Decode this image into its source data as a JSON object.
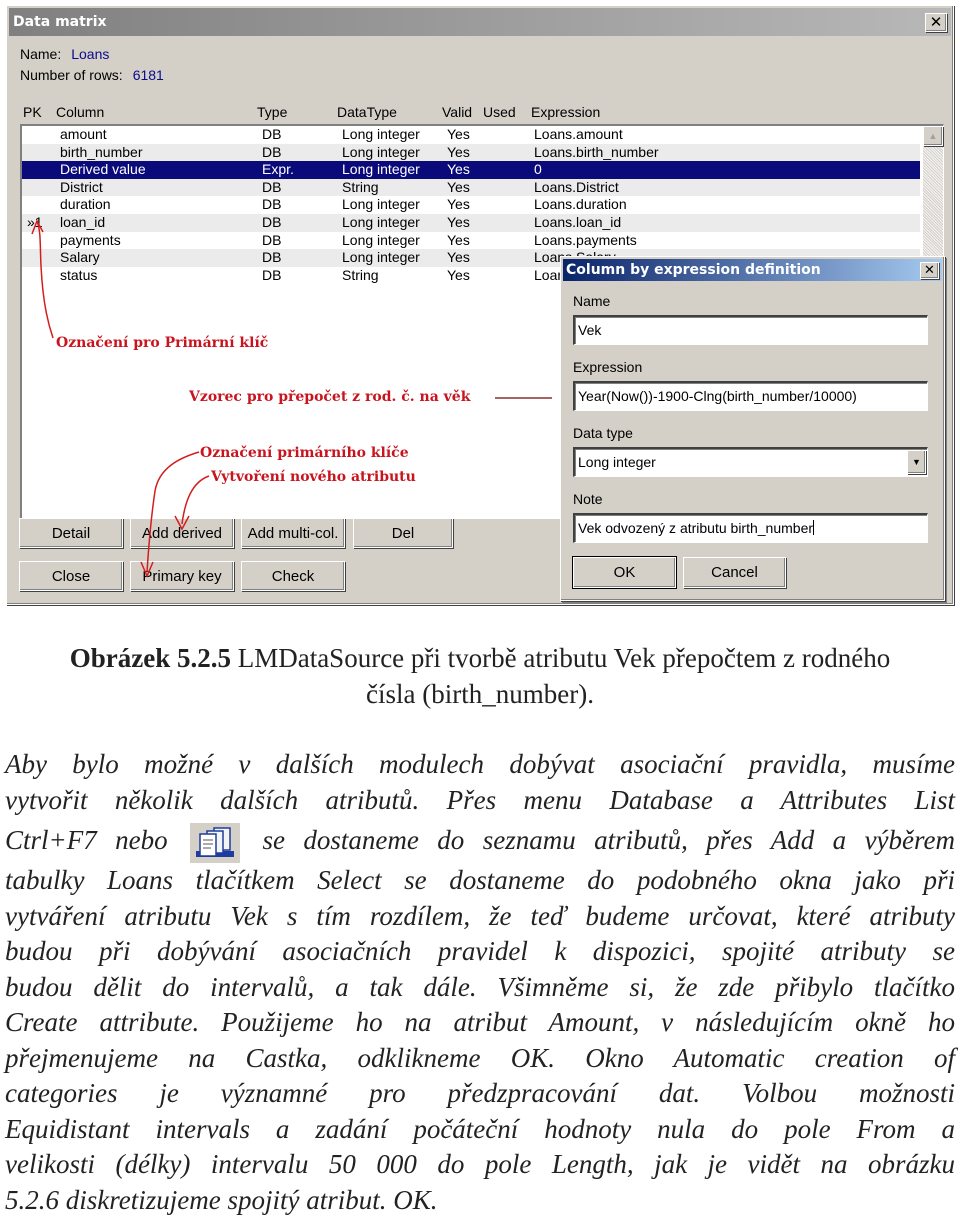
{
  "window": {
    "title": "Data matrix",
    "name_label": "Name:",
    "name_value": "Loans",
    "rows_label": "Number of rows:",
    "rows_value": "6181"
  },
  "columns": {
    "pk": "PK",
    "column": "Column",
    "type": "Type",
    "datatype": "DataType",
    "valid": "Valid",
    "used": "Used",
    "expression": "Expression"
  },
  "rows": [
    {
      "pk": "",
      "column": "amount",
      "type": "DB",
      "datatype": "Long integer",
      "valid": "Yes",
      "expression": "Loans.amount"
    },
    {
      "pk": "",
      "column": "birth_number",
      "type": "DB",
      "datatype": "Long integer",
      "valid": "Yes",
      "expression": "Loans.birth_number"
    },
    {
      "pk": "",
      "column": "Derived value",
      "type": "Expr.",
      "datatype": "Long integer",
      "valid": "Yes",
      "expression": "0"
    },
    {
      "pk": "",
      "column": "District",
      "type": "DB",
      "datatype": "String",
      "valid": "Yes",
      "expression": "Loans.District"
    },
    {
      "pk": "",
      "column": "duration",
      "type": "DB",
      "datatype": "Long integer",
      "valid": "Yes",
      "expression": "Loans.duration"
    },
    {
      "pk": "»1",
      "column": "loan_id",
      "type": "DB",
      "datatype": "Long integer",
      "valid": "Yes",
      "expression": "Loans.loan_id"
    },
    {
      "pk": "",
      "column": "payments",
      "type": "DB",
      "datatype": "Long integer",
      "valid": "Yes",
      "expression": "Loans.payments"
    },
    {
      "pk": "",
      "column": "Salary",
      "type": "DB",
      "datatype": "Long integer",
      "valid": "Yes",
      "expression": "Loans.Salary"
    },
    {
      "pk": "",
      "column": "status",
      "type": "DB",
      "datatype": "String",
      "valid": "Yes",
      "expression": "Loans.status"
    }
  ],
  "selected_row_index": 2,
  "annotations": {
    "pk_marker": "Označení pro Primární klíč",
    "formula": "Vzorec pro přepočet z rod. č. na věk",
    "pk_button": "Označení primárního klíče",
    "new_attr": "Vytvoření nového atributu"
  },
  "buttons": {
    "detail": "Detail",
    "add_derived": "Add derived",
    "add_multi": "Add multi-col.",
    "del": "Del",
    "close": "Close",
    "primary_key": "Primary key",
    "check": "Check"
  },
  "dialog": {
    "title": "Column by expression definition",
    "name_label": "Name",
    "name_value": "Vek",
    "expression_label": "Expression",
    "expression_value": "Year(Now())-1900-Clng(birth_number/10000)",
    "datatype_label": "Data type",
    "datatype_value": "Long integer",
    "note_label": "Note",
    "note_value": "Vek odvozený z atributu birth_number",
    "ok": "OK",
    "cancel": "Cancel"
  },
  "colors": {
    "selection": "#0a0a7a",
    "annotation": "#c8141e",
    "window_face": "#d4d0c8"
  },
  "document": {
    "caption_bold": "Obrázek 5.2.5",
    "caption_text": " LMDataSource při tvorbě atributu Vek přepočtem z rodného",
    "caption_line2": "čísla (birth_number).",
    "paragraph_lines": [
      "Aby bylo možné v dalších modulech dobývat asociační pravidla, musíme",
      "vytvořit několik dalších atributů. Přes menu Database a Attributes List",
      "se dostaneme do seznamu atributů, přes Add a výběrem",
      "tabulky Loans tlačítkem Select  se dostaneme do podobného okna jako při",
      "vytváření atributu Vek s tím rozdílem, že teď budeme určovat, které atributy",
      "budou při dobývání asociačních pravidel k dispozici, spojité atributy se",
      "budou dělit do intervalů, a tak dále.  Všimněme si, že zde přibylo tlačítko",
      "Create attribute. Použijeme ho na atribut Amount, v následujícím okně ho",
      "přejmenujeme na Castka, odklikneme OK. Okno Automatic creation of",
      "categories je významné pro předzpracování dat. Volbou možnosti",
      "Equidistant intervals a zadání počáteční hodnoty nula do pole From a",
      "velikosti (délky) intervalu 50 000 do pole Length, jak je vidět na obrázku",
      "5.2.6 diskretizujeme spojitý atribut. OK."
    ],
    "line3_prefix": "Ctrl+F7 nebo",
    "inline_icon": "attributes-list-icon"
  }
}
